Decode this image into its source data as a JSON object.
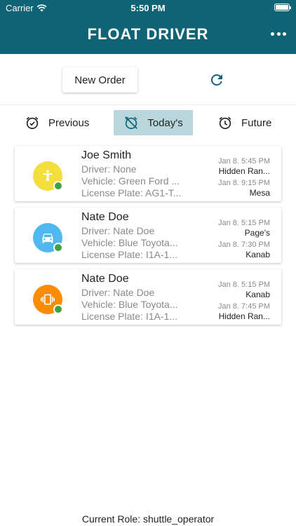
{
  "status_bar": {
    "carrier": "Carrier",
    "time": "5:50 PM"
  },
  "header": {
    "title": "FLOAT DRIVER",
    "menu_icon": "more-dots-icon",
    "bg_color": "#0e6374"
  },
  "toolbar": {
    "new_order_label": "New Order",
    "refresh_icon": "refresh-icon"
  },
  "tabs": [
    {
      "label": "Previous",
      "icon": "alarm-check-icon",
      "active": false
    },
    {
      "label": "Today's",
      "icon": "alarm-off-icon",
      "active": true
    },
    {
      "label": "Future",
      "icon": "alarm-icon",
      "active": false
    }
  ],
  "orders": [
    {
      "name": "Joe Smith",
      "driver": "Driver: None",
      "vehicle": "Vehicle: Green Ford ...",
      "plate": "License Plate: AG1-T...",
      "pickup_time": "Jan 8. 5:45 PM",
      "pickup_place": "Hidden Ran...",
      "dropoff_time": "Jan 8. 9:15 PM",
      "dropoff_place": "Mesa",
      "avatar_color": "#f4de3c",
      "avatar_icon": "person-icon"
    },
    {
      "name": "Nate Doe",
      "driver": "Driver: Nate Doe",
      "vehicle": "Vehicle: Blue Toyota...",
      "plate": "License Plate: I1A-1...",
      "pickup_time": "Jan 8. 5:15 PM",
      "pickup_place": "Page's",
      "dropoff_time": "Jan 8. 7:30 PM",
      "dropoff_place": "Kanab",
      "avatar_color": "#4fb8ee",
      "avatar_icon": "car-icon"
    },
    {
      "name": "Nate Doe",
      "driver": "Driver: Nate Doe",
      "vehicle": "Vehicle: Blue Toyota...",
      "plate": "License Plate: I1A-1...",
      "pickup_time": "Jan 8. 5:15 PM",
      "pickup_place": "Kanab",
      "dropoff_time": "Jan 8. 7:45 PM",
      "dropoff_place": "Hidden Ran...",
      "avatar_color": "#fb8c00",
      "avatar_icon": "vibrate-icon"
    }
  ],
  "status_dot_color": "#43a047",
  "footer": {
    "role_text": "Current Role: shuttle_operator"
  }
}
